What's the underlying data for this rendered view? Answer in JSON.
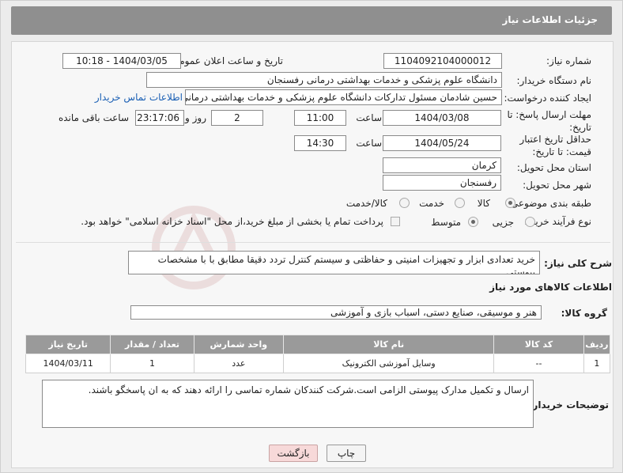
{
  "header": {
    "title": "جزئیات اطلاعات نیاز"
  },
  "form": {
    "need_number_label": "شماره نیاز:",
    "need_number": "1104092104000012",
    "announce_label": "تاریخ و ساعت اعلان عمومی:",
    "announce_value": "1404/03/05 - 10:18",
    "buyer_org_label": "نام دستگاه خریدار:",
    "buyer_org": "دانشگاه علوم پزشکی و خدمات بهداشتی درمانی رفسنجان",
    "requester_label": "ایجاد کننده درخواست:",
    "requester": "حسین شادمان مسئول تدارکات دانشگاه علوم پزشکی و خدمات بهداشتی درمانی رفسنجان",
    "buyer_contact_link": "اطلاعات تماس خریدار",
    "reply_deadline_label": "مهلت ارسال پاسخ: تا تاریخ:",
    "reply_date": "1404/03/08",
    "time_label": "ساعت",
    "reply_time": "11:00",
    "days_value": "2",
    "days_label": "روز و",
    "remaining_time": "23:17:06",
    "remaining_label": "ساعت باقی مانده",
    "price_validity_label": "حداقل تاریخ اعتبار قیمت: تا تاریخ:",
    "price_date": "1404/05/24",
    "price_time": "14:30",
    "province_label": "استان محل تحویل:",
    "province": "کرمان",
    "city_label": "شهر محل تحویل:",
    "city": "رفسنجان",
    "category_label": "طبقه بندی موضوعی:",
    "category_options": [
      "کالا",
      "خدمت",
      "کالا/خدمت"
    ],
    "category_selected": "کالا",
    "process_label": "نوع فرآیند خرید :",
    "process_options": [
      "جزیی",
      "متوسط"
    ],
    "process_selected": "متوسط",
    "payment_note": "پرداخت تمام یا بخشی از مبلغ خرید،از محل \"اسناد خزانه اسلامی\" خواهد بود.",
    "description_label": "شرح کلی نیاز:",
    "description": "خرید تعدادی ابزار و تجهیزات امنیتی و حفاظتی و سیستم کنترل تردد دقیقا مطابق با  با مشخصات پیوستی"
  },
  "goods": {
    "section_title": "اطلاعات کالاهای مورد نیاز",
    "group_label": "گروه کالا:",
    "group_value": "هنر و موسیقی، صنایع دستی، اسباب بازی و آموزشی",
    "columns": [
      "ردیف",
      "کد کالا",
      "نام کالا",
      "واحد شمارش",
      "تعداد / مقدار",
      "تاریخ نیاز"
    ],
    "rows": [
      [
        "1",
        "--",
        "وسایل آموزشی الکترونیک",
        "عدد",
        "1",
        "1404/03/11"
      ]
    ]
  },
  "buyer_notes": {
    "label": "توضیحات خریدار:",
    "text": "ارسال و تکمیل مدارک پیوستی الزامی است.شرکت کنندکان شماره تماسی را ارائه دهند که به ان پاسخگو باشند."
  },
  "buttons": {
    "print": "چاپ",
    "back": "بازگشت"
  },
  "colors": {
    "header_bg": "#8f8f8f",
    "link": "#1a5fb4",
    "back_button": "#f7d9d9"
  }
}
